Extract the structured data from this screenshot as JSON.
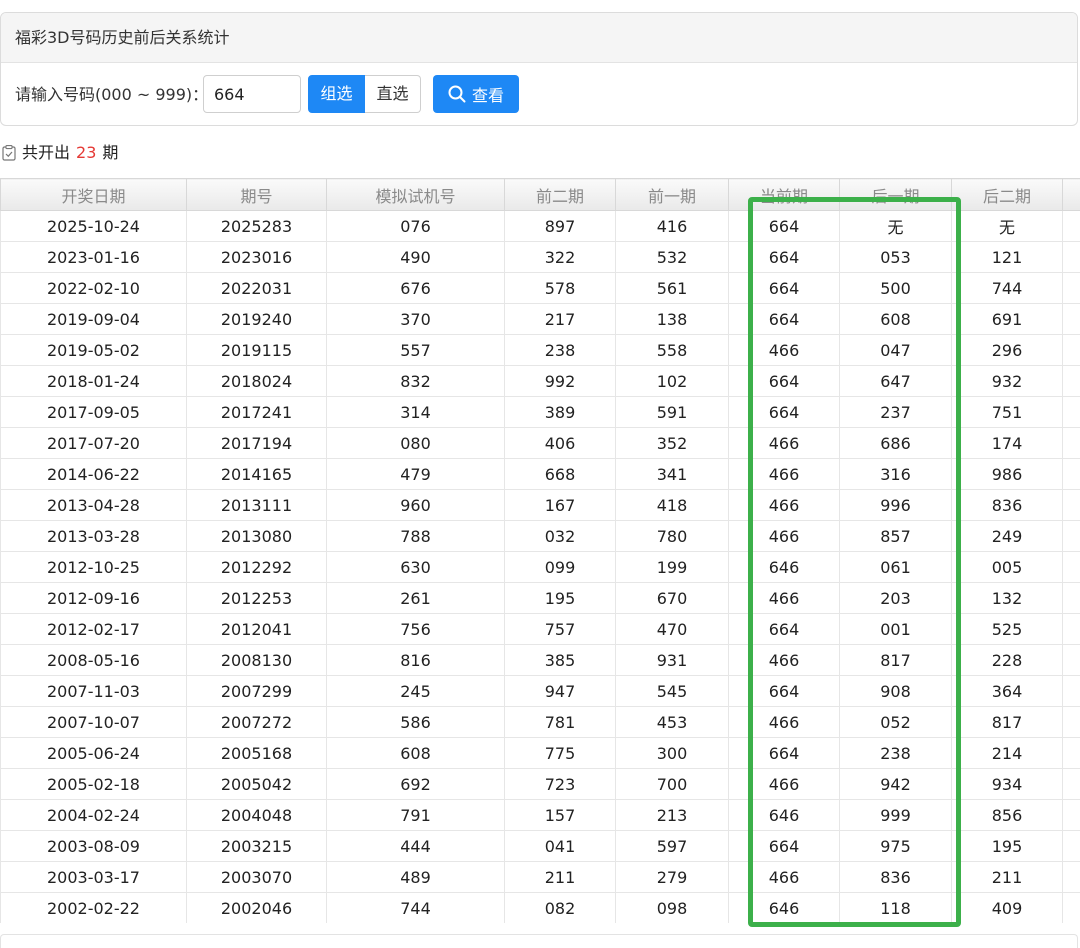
{
  "header": {
    "title": "福彩3D号码历史前后关系统计"
  },
  "form": {
    "label": "请输入号码(000 ~ 999)：",
    "input_value": "664",
    "option_group": "组选",
    "option_direct": "直选",
    "search_label": "查看"
  },
  "summary": {
    "prefix": "共开出",
    "count": "23",
    "suffix": "期"
  },
  "table": {
    "columns": [
      "开奖日期",
      "期号",
      "模拟试机号",
      "前二期",
      "前一期",
      "当前期",
      "后一期",
      "后二期"
    ],
    "rows": [
      [
        "2025-10-24",
        "2025283",
        "076",
        "897",
        "416",
        "664",
        "无",
        "无"
      ],
      [
        "2023-01-16",
        "2023016",
        "490",
        "322",
        "532",
        "664",
        "053",
        "121"
      ],
      [
        "2022-02-10",
        "2022031",
        "676",
        "578",
        "561",
        "664",
        "500",
        "744"
      ],
      [
        "2019-09-04",
        "2019240",
        "370",
        "217",
        "138",
        "664",
        "608",
        "691"
      ],
      [
        "2019-05-02",
        "2019115",
        "557",
        "238",
        "558",
        "466",
        "047",
        "296"
      ],
      [
        "2018-01-24",
        "2018024",
        "832",
        "992",
        "102",
        "664",
        "647",
        "932"
      ],
      [
        "2017-09-05",
        "2017241",
        "314",
        "389",
        "591",
        "664",
        "237",
        "751"
      ],
      [
        "2017-07-20",
        "2017194",
        "080",
        "406",
        "352",
        "466",
        "686",
        "174"
      ],
      [
        "2014-06-22",
        "2014165",
        "479",
        "668",
        "341",
        "466",
        "316",
        "986"
      ],
      [
        "2013-04-28",
        "2013111",
        "960",
        "167",
        "418",
        "466",
        "996",
        "836"
      ],
      [
        "2013-03-28",
        "2013080",
        "788",
        "032",
        "780",
        "466",
        "857",
        "249"
      ],
      [
        "2012-10-25",
        "2012292",
        "630",
        "099",
        "199",
        "646",
        "061",
        "005"
      ],
      [
        "2012-09-16",
        "2012253",
        "261",
        "195",
        "670",
        "466",
        "203",
        "132"
      ],
      [
        "2012-02-17",
        "2012041",
        "756",
        "757",
        "470",
        "664",
        "001",
        "525"
      ],
      [
        "2008-05-16",
        "2008130",
        "816",
        "385",
        "931",
        "466",
        "817",
        "228"
      ],
      [
        "2007-11-03",
        "2007299",
        "245",
        "947",
        "545",
        "664",
        "908",
        "364"
      ],
      [
        "2007-10-07",
        "2007272",
        "586",
        "781",
        "453",
        "466",
        "052",
        "817"
      ],
      [
        "2005-06-24",
        "2005168",
        "608",
        "775",
        "300",
        "664",
        "238",
        "214"
      ],
      [
        "2005-02-18",
        "2005042",
        "692",
        "723",
        "700",
        "466",
        "942",
        "934"
      ],
      [
        "2004-02-24",
        "2004048",
        "791",
        "157",
        "213",
        "646",
        "999",
        "856"
      ],
      [
        "2003-08-09",
        "2003215",
        "444",
        "041",
        "597",
        "664",
        "975",
        "195"
      ],
      [
        "2003-03-17",
        "2003070",
        "489",
        "211",
        "279",
        "466",
        "836",
        "211"
      ],
      [
        "2002-02-22",
        "2002046",
        "744",
        "082",
        "098",
        "646",
        "118",
        "409"
      ]
    ]
  },
  "colors": {
    "accent": "#1e88f5",
    "highlight": "#3cb04a",
    "count": "#e53935"
  }
}
